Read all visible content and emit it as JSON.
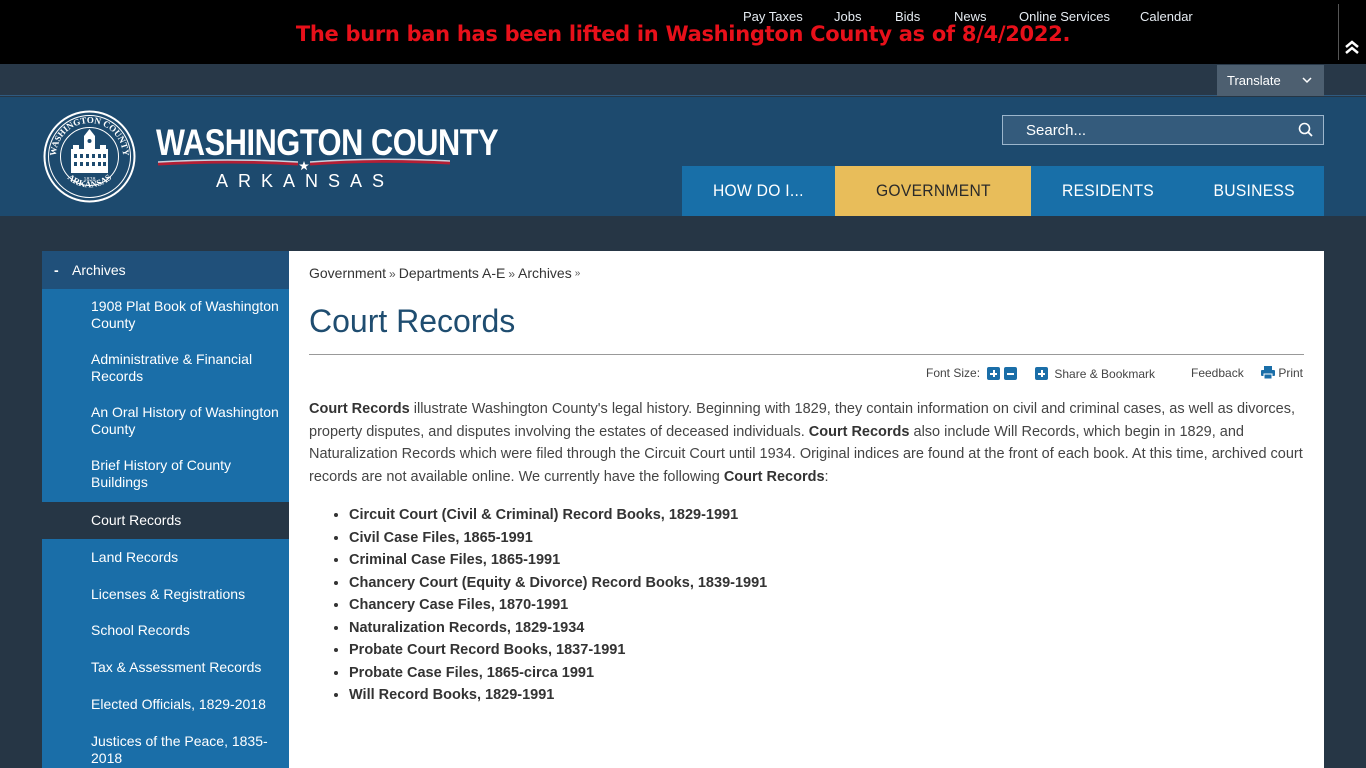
{
  "alert": {
    "message": "The burn ban has been lifted in Washington County as of 8/4/2022.",
    "collapse_icon": "double-chevron-up-icon"
  },
  "utility_nav": {
    "links": [
      "Pay Taxes",
      "Jobs",
      "Bids",
      "News",
      "Online Services",
      "Calendar"
    ],
    "translate_label": "Translate"
  },
  "header": {
    "logo_title": "WASHINGTON COUNTY",
    "logo_subtitle": "ARKANSAS",
    "seal_text_top": "WASHINGTON COUNTY",
    "seal_text_bottom": "ARKANSAS",
    "seal_year": "1828",
    "search_placeholder": "Search..."
  },
  "main_nav": {
    "items": [
      {
        "label": "HOW DO I...",
        "active": false
      },
      {
        "label": "GOVERNMENT",
        "active": true
      },
      {
        "label": "RESIDENTS",
        "active": false
      },
      {
        "label": "BUSINESS",
        "active": false
      }
    ]
  },
  "sidebar": {
    "section_toggle": "-",
    "section_title": "Archives",
    "items": [
      {
        "label": "1908 Plat Book of Washington County",
        "active": false
      },
      {
        "label": "Administrative & Financial Records",
        "active": false
      },
      {
        "label": "An Oral History of Washington County",
        "active": false
      },
      {
        "label": "Brief History of County Buildings",
        "active": false
      },
      {
        "label": "Court Records",
        "active": true
      },
      {
        "label": "Land Records",
        "active": false
      },
      {
        "label": "Licenses & Registrations",
        "active": false
      },
      {
        "label": "School Records",
        "active": false
      },
      {
        "label": "Tax & Assessment Records",
        "active": false
      },
      {
        "label": "Elected Officials, 1829-2018",
        "active": false
      },
      {
        "label": "Justices of the Peace, 1835-2018",
        "active": false
      }
    ]
  },
  "breadcrumb": {
    "items": [
      "Government",
      "Departments A-E",
      "Archives"
    ],
    "separator": "»"
  },
  "page": {
    "title": "Court Records",
    "tools": {
      "font_size_label": "Font Size:",
      "share_label": "Share & Bookmark",
      "feedback_label": "Feedback",
      "print_label": "Print"
    },
    "intro": {
      "b1": "Court Records",
      "t1": " illustrate Washington County's legal history. Beginning with 1829, they contain information on civil and criminal cases, as well as divorces, property disputes, and disputes involving the estates of deceased individuals. ",
      "b2": "Court Records",
      "t2": " also include Will Records, which begin in 1829, and Naturalization Records which were filed through the Circuit Court until 1934. Original indices are found at the front of each book. At this time, archived court records are not available online. We currently have the following ",
      "b3": "Court Records",
      "t3": ":"
    },
    "records": [
      "Circuit Court (Civil & Criminal) Record Books, 1829-1991",
      "Civil Case Files, 1865-1991",
      "Criminal Case Files, 1865-1991",
      "Chancery Court (Equity & Divorce) Record Books, 1839-1991",
      "Chancery Case Files, 1870-1991",
      "Naturalization Records, 1829-1934",
      "Probate Court Record Books, 1837-1991",
      "Probate Case Files, 1865-circa 1991",
      "Will Record Books, 1829-1991"
    ]
  },
  "colors": {
    "alert_text": "#e8101a",
    "header_bg": "#1d4a6e",
    "nav_blue": "#186fa8",
    "nav_active": "#e8bd5a",
    "title_blue": "#1f4d70"
  }
}
